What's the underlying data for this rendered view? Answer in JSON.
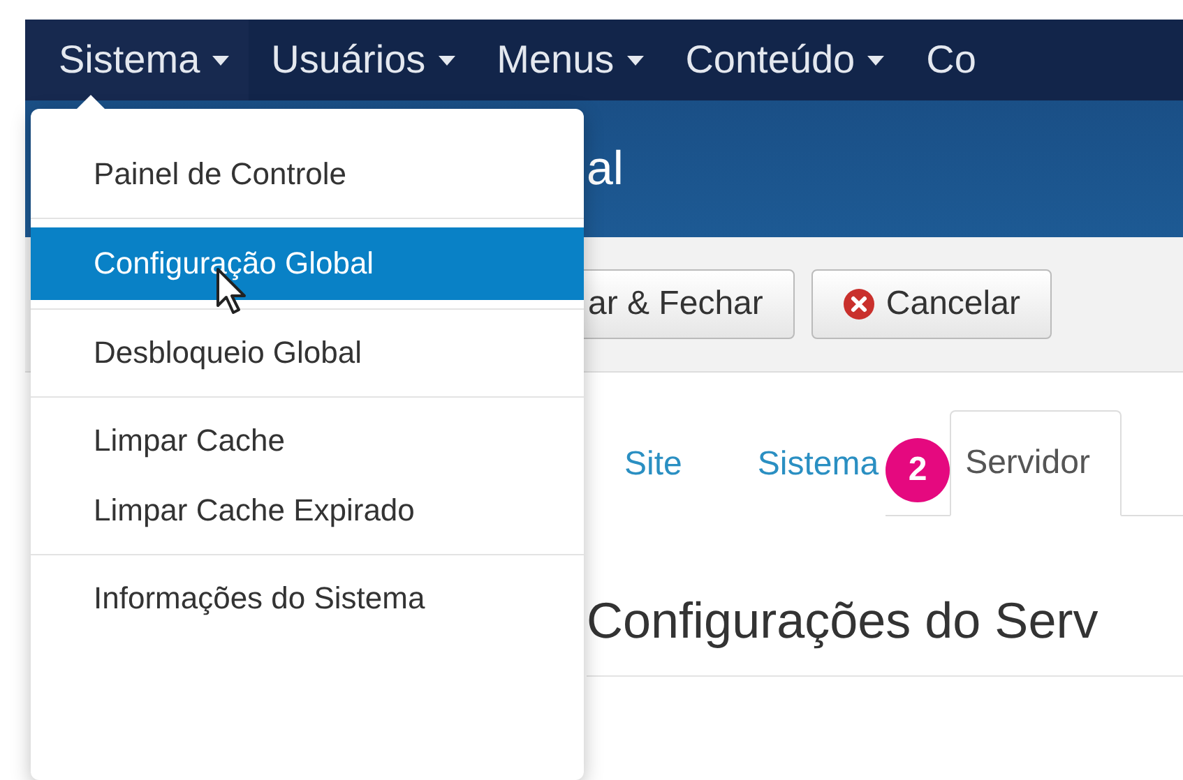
{
  "navbar": {
    "items": [
      {
        "label": "Sistema",
        "selected": true,
        "caret": true
      },
      {
        "label": "Usuários",
        "selected": false,
        "caret": true
      },
      {
        "label": "Menus",
        "selected": false,
        "caret": true
      },
      {
        "label": "Conteúdo",
        "selected": false,
        "caret": true
      },
      {
        "label": "Co",
        "selected": false,
        "caret": false
      }
    ]
  },
  "header": {
    "title": "al"
  },
  "toolbar": {
    "buttons": [
      {
        "label": "ar & Fechar",
        "kind": "plain"
      },
      {
        "label": "Cancelar",
        "kind": "cancel"
      }
    ]
  },
  "tabs": [
    {
      "label": "Site",
      "selected": false
    },
    {
      "label": "Sistema",
      "selected": false
    },
    {
      "label": "Servidor",
      "selected": true
    }
  ],
  "step_badge": "2",
  "heading": "Configurações do Serv",
  "dropdown": {
    "groups": [
      [
        {
          "label": "Painel de Controle",
          "selected": false
        }
      ],
      [
        {
          "label": "Configuração Global",
          "selected": true
        }
      ],
      [
        {
          "label": "Desbloqueio Global",
          "selected": false
        }
      ],
      [
        {
          "label": "Limpar Cache",
          "selected": false
        },
        {
          "label": "Limpar Cache Expirado",
          "selected": false
        }
      ],
      [
        {
          "label": "Informações do Sistema",
          "selected": false
        }
      ]
    ]
  }
}
